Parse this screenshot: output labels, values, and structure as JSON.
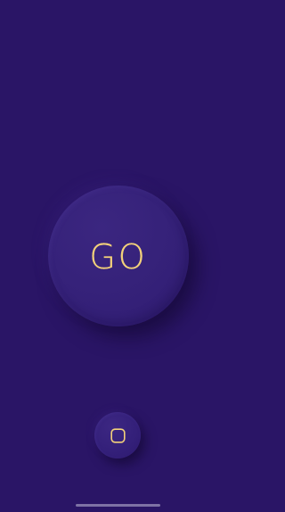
{
  "screen": {
    "background_color": "#2a1566",
    "accent_color": "#f4d27a"
  },
  "go_button": {
    "label": "GO"
  },
  "stop_button": {
    "icon": "rounded-square-icon"
  },
  "home_indicator": {
    "visible": true
  }
}
